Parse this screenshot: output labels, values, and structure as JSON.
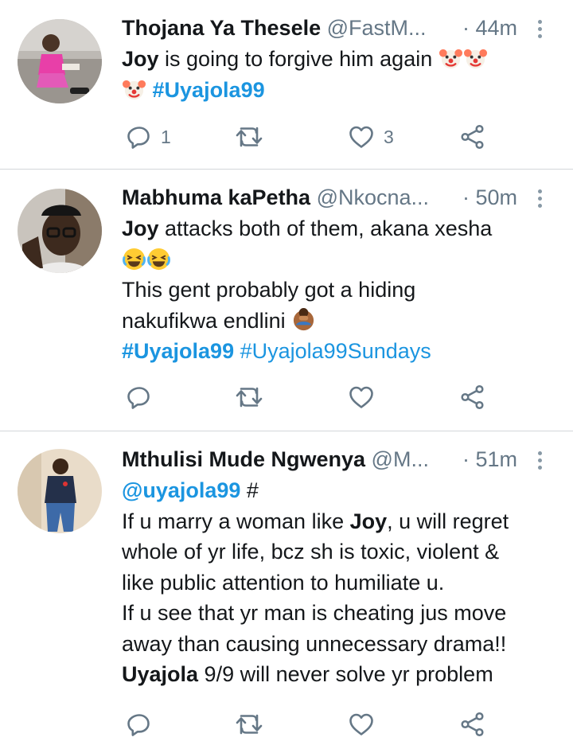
{
  "colors": {
    "link": "#1b95e0",
    "secondary": "#657786",
    "divider": "#d3d6da"
  },
  "tweets": [
    {
      "name": "Thojana Ya Thesele",
      "handle": "@FastM...",
      "time": "· 44m",
      "line1_bold": "Joy",
      "line1_rest": " is going to forgive him again ",
      "hashtag": "#Uyajola99",
      "emoji_icon": "clown-face-emoji",
      "reply_count": "1",
      "like_count": "3"
    },
    {
      "name": "Mabhuma kaPetha",
      "handle": "@Nkocna...",
      "time": "· 50m",
      "line1_bold": "Joy",
      "line1_rest": " attacks both of them, akana xesha",
      "line3": "This gent probably got a hiding",
      "line4": "nakufikwa endlini ",
      "hashtag1": "#Uyajola99",
      "hashtag2": "#Uyajola99Sundays",
      "emoji_icon": "crying-laughing-emoji"
    },
    {
      "name": "Mthulisi Mude Ngwenya",
      "handle": "@M...",
      "time": "· 51m",
      "mention": "@uyajola99",
      "mention_rest": " #",
      "line2a": "If u marry a woman like ",
      "line2_bold": "Joy",
      "line2b": ", u will regret",
      "line3": "whole of yr life, bcz sh is toxic, violent &",
      "line4": "like public attention to humiliate u.",
      "line5": "If u see that yr man is cheating jus move",
      "line6": "away than causing unnecessary drama!!",
      "line7_bold": "Uyajola",
      "line7_rest": " 9/9 will never solve yr problem"
    }
  ]
}
